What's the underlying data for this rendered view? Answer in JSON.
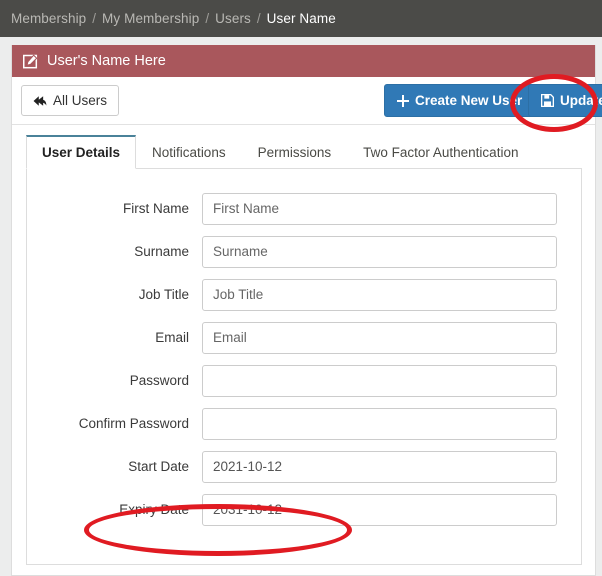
{
  "breadcrumb": {
    "separator": "/",
    "items": [
      {
        "label": "Membership",
        "active": false
      },
      {
        "label": "My Membership",
        "active": false
      },
      {
        "label": "Users",
        "active": false
      },
      {
        "label": "User Name",
        "active": true
      }
    ]
  },
  "panel": {
    "heading": "User's Name Here",
    "heading_icon": "pencil-square-icon",
    "heading_color": "#a9575c"
  },
  "toolbar": {
    "all_users_label": "All Users",
    "all_users_icon": "reply-back-arrow-icon",
    "create_label": "Create New User",
    "create_icon": "plus-icon",
    "update_label": "Update",
    "update_icon": "floppy-save-icon",
    "primary_color": "#3079b6"
  },
  "tabs": [
    {
      "label": "User Details",
      "active": true
    },
    {
      "label": "Notifications",
      "active": false
    },
    {
      "label": "Permissions",
      "active": false
    },
    {
      "label": "Two Factor Authentication",
      "active": false
    }
  ],
  "form": {
    "fields": [
      {
        "label": "First Name",
        "value": "",
        "placeholder": "First Name"
      },
      {
        "label": "Surname",
        "value": "",
        "placeholder": "Surname"
      },
      {
        "label": "Job Title",
        "value": "",
        "placeholder": "Job Title"
      },
      {
        "label": "Email",
        "value": "",
        "placeholder": "Email"
      },
      {
        "label": "Password",
        "value": "",
        "placeholder": ""
      },
      {
        "label": "Confirm Password",
        "value": "",
        "placeholder": ""
      },
      {
        "label": "Start Date",
        "value": "2021-10-12",
        "placeholder": ""
      },
      {
        "label": "Expiry Date",
        "value": "2031-10-12",
        "placeholder": ""
      }
    ]
  },
  "annotations": {
    "color": "#e01b22",
    "shapes": [
      {
        "name": "update-button-highlight",
        "target": "Update"
      },
      {
        "name": "expiry-date-highlight",
        "target": "Expiry Date"
      }
    ]
  }
}
